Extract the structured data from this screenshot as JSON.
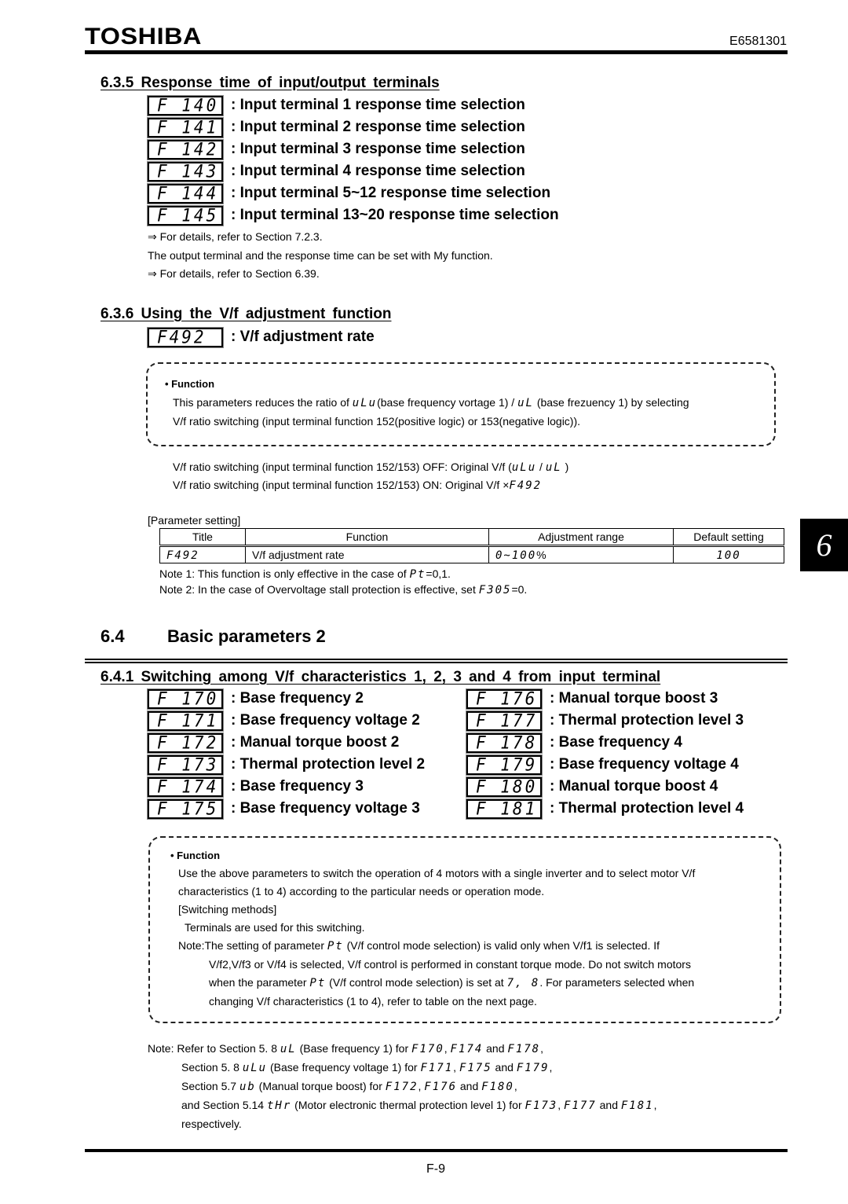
{
  "header": {
    "brand": "TOSHIBA",
    "doc_number": "E6581301"
  },
  "footer": {
    "page_number": "F-9"
  },
  "side_tab": {
    "chapter": "6"
  },
  "section_635": {
    "heading": "6.3.5 Response time of input/output terminals",
    "params": [
      {
        "code": "F 140",
        "label": ": Input terminal 1 response time selection"
      },
      {
        "code": "F 141",
        "label": ": Input terminal 2 response time selection"
      },
      {
        "code": "F 142",
        "label": ": Input terminal 3 response time selection"
      },
      {
        "code": "F 143",
        "label": ": Input terminal 4 response time selection"
      },
      {
        "code": "F 144",
        "label": ": Input terminal 5~12 response time selection"
      },
      {
        "code": "F 145",
        "label": ": Input terminal 13~20 response time selection"
      }
    ],
    "ref1": "⇒ For details, refer to Section 7.2.3.",
    "note": "The output terminal and the response time can be set with  My function.",
    "ref2": "⇒ For details, refer to Section 6.39."
  },
  "section_636": {
    "heading": "6.3.6 Using the V/f adjustment function",
    "param": {
      "code": "F492",
      "label": ": V/f adjustment rate"
    },
    "function_box": {
      "title": "• Function",
      "line1_a": "This parameters reduces the ratio of ",
      "line1_code1": "uLu",
      "line1_b": "(base frequency vortage 1) / ",
      "line1_code2": "uL",
      "line1_c": " (base frezuency 1) by selecting",
      "line2": "V/f ratio switching (input terminal function 152(positive logic) or 153(negative logic))."
    },
    "off_line_a": "V/f ratio switching (input terminal function 152/153) OFF: Original V/f (",
    "off_code1": "uLu",
    "off_sep": " / ",
    "off_code2": "uL",
    "off_line_b": " )",
    "on_line_a": "V/f ratio switching (input terminal function 152/153) ON: Original V/f  ×",
    "on_code": "F492",
    "param_setting_label": "[Parameter setting]",
    "table": {
      "headers": [
        "Title",
        "Function",
        "Adjustment range",
        "Default setting"
      ],
      "rows": [
        {
          "title": "F492",
          "function": "V/f adjustment rate",
          "range_code": "0~100",
          "range_unit": "%",
          "default": "100"
        }
      ]
    },
    "note1_a": "Note 1: This function is only effective in the case of ",
    "note1_code": "Pt",
    "note1_b": "=0,1.",
    "note2_a": "Note 2: In the case of Overvoltage stall protection is effective, set ",
    "note2_code": "F305",
    "note2_b": "=0."
  },
  "section_64": {
    "number": "6.4",
    "title": "Basic parameters 2"
  },
  "section_641": {
    "heading": "6.4.1 Switching among V/f characteristics 1, 2, 3 and 4 from input terminal",
    "params_left": [
      {
        "code": "F 170",
        "label": ": Base frequency 2"
      },
      {
        "code": "F 171",
        "label": ": Base frequency voltage 2"
      },
      {
        "code": "F 172",
        "label": ": Manual torque boost 2"
      },
      {
        "code": "F 173",
        "label": ": Thermal protection level 2"
      },
      {
        "code": "F 174",
        "label": ": Base frequency 3"
      },
      {
        "code": "F 175",
        "label": ": Base frequency voltage 3"
      }
    ],
    "params_right": [
      {
        "code": "F 176",
        "label": ": Manual torque boost 3"
      },
      {
        "code": "F 177",
        "label": ": Thermal protection level 3"
      },
      {
        "code": "F 178",
        "label": ": Base frequency 4"
      },
      {
        "code": "F 179",
        "label": ": Base frequency voltage 4"
      },
      {
        "code": "F 180",
        "label": ": Manual torque boost 4"
      },
      {
        "code": "F 181",
        "label": ": Thermal protection level 4"
      }
    ],
    "function_box": {
      "title": "• Function",
      "p1": "Use the above parameters to switch the operation of 4 motors with a single inverter and to select motor V/f",
      "p2": "characteristics (1 to 4) according to the particular needs or operation mode.",
      "p3": "[Switching methods]",
      "p4": " Terminals are used for this switching.",
      "note_a": "Note:The setting of parameter ",
      "note_code1": "Pt",
      "note_b": " (V/f control mode selection) is valid only when V/f1 is selected. If",
      "note_l2": "V/f2,V/f3 or V/f4 is selected, V/f control is performed in constant torque mode. Do not switch motors",
      "note_l3_a": "when the parameter ",
      "note_code2": "Pt",
      "note_l3_b": " (V/f control mode selection) is set at ",
      "note_code3": "7, 8",
      "note_l3_c": ". For parameters selected when",
      "note_l4": "changing V/f characteristics (1 to 4), refer to table on the next page."
    },
    "refs": [
      {
        "pre": "Note: Refer to Section 5. 8 ",
        "code": "uL",
        "desc": " (Base frequency 1) for ",
        "p1": "F170",
        "p2": "F174",
        "and": " and ",
        "p3": "F178",
        "end": ","
      },
      {
        "pre": "Section 5. 8 ",
        "code": "uLu",
        "desc": " (Base frequency voltage 1) for ",
        "p1": "F171",
        "p2": "F175",
        "and": " and ",
        "p3": "F179",
        "end": ","
      },
      {
        "pre": "Section 5.7 ",
        "code": "ub",
        "desc": " (Manual torque boost) for ",
        "p1": "F172",
        "p2": "F176",
        "and": " and ",
        "p3": "F180",
        "end": ","
      },
      {
        "pre": "and Section 5.14 ",
        "code": "tHr",
        "desc": " (Motor electronic thermal protection level 1) for ",
        "p1": "F173",
        "p2": "F177",
        "and": " and ",
        "p3": "F181",
        "end": ","
      }
    ],
    "refs_end": "respectively."
  }
}
